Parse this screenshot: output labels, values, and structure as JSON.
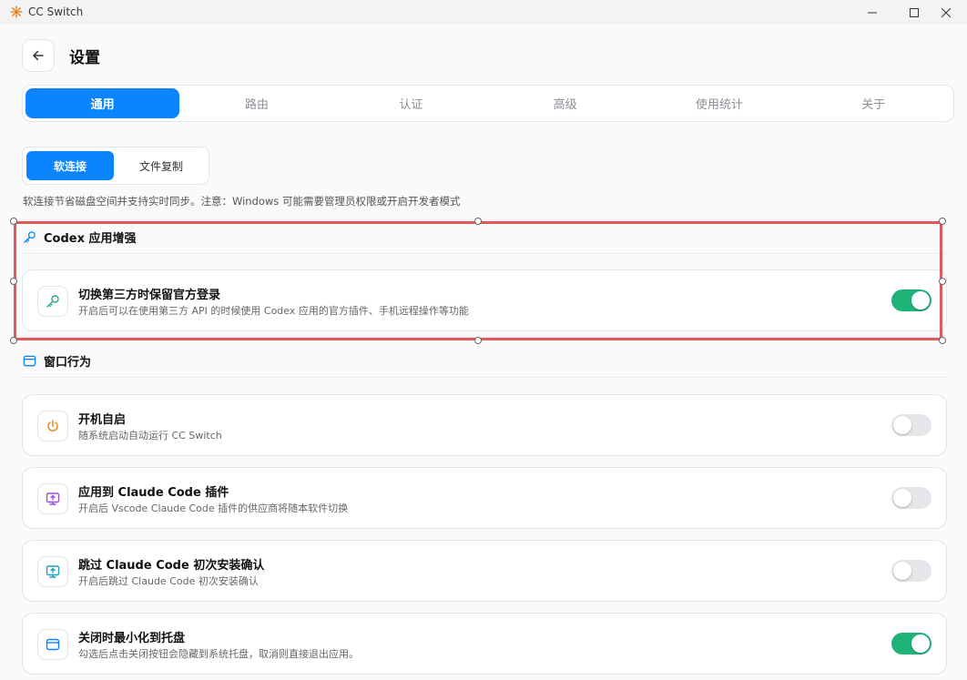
{
  "window": {
    "app_title": "CC Switch",
    "minimize_symbol": "—",
    "maximize_symbol": "☐",
    "close_symbol": "✕"
  },
  "header": {
    "title": "设置"
  },
  "tabs": [
    {
      "label": "通用",
      "active": true
    },
    {
      "label": "路由",
      "active": false
    },
    {
      "label": "认证",
      "active": false
    },
    {
      "label": "高级",
      "active": false
    },
    {
      "label": "使用统计",
      "active": false
    },
    {
      "label": "关于",
      "active": false
    }
  ],
  "link_mode": {
    "options": [
      {
        "label": "软连接",
        "active": true
      },
      {
        "label": "文件复制",
        "active": false
      }
    ],
    "hint": "软连接节省磁盘空间并支持实时同步。注意：Windows 可能需要管理员权限或开启开发者模式"
  },
  "codex_section": {
    "title": "Codex 应用增强",
    "icon": "key-icon",
    "items": [
      {
        "icon": "key-icon",
        "title": "切换第三方时保留官方登录",
        "desc": "开启后可以在使用第三方 API 的时候使用 Codex 应用的官方插件、手机远程操作等功能",
        "enabled": true
      }
    ]
  },
  "window_section": {
    "title": "窗口行为",
    "icon": "window-icon",
    "items": [
      {
        "icon": "power-icon",
        "title": "开机自启",
        "desc": "随系统启动自动运行 CC Switch",
        "enabled": false
      },
      {
        "icon": "monitor-icon",
        "title": "应用到 Claude Code 插件",
        "desc": "开启后 Vscode Claude Code 插件的供应商将随本软件切换",
        "enabled": false
      },
      {
        "icon": "monitor-icon",
        "title": "跳过 Claude Code 初次安装确认",
        "desc": "开启后跳过 Claude Code 初次安装确认",
        "enabled": false
      },
      {
        "icon": "window-icon",
        "title": "关闭时最小化到托盘",
        "desc": "勾选后点击关闭按钮会隐藏到系统托盘，取消则直接退出应用。",
        "enabled": true
      }
    ]
  },
  "colors": {
    "accent": "#0a84ff",
    "toggle_on": "#1fb378",
    "selection": "#e05a5a"
  }
}
